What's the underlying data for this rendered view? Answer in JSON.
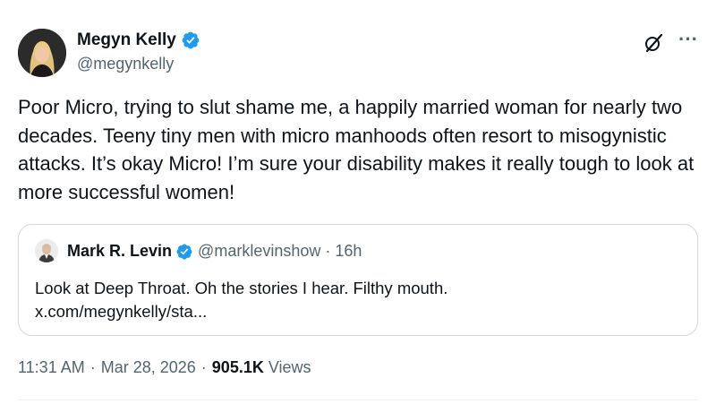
{
  "author": {
    "name": "Megyn Kelly",
    "handle": "@megynkelly",
    "verified_color": "#1d9bf0"
  },
  "icons": [
    "grok-icon",
    "more-icon"
  ],
  "tweet_text": "Poor Micro, trying to slut shame me, a happily married woman for nearly two decades. Teeny tiny men with micro manhoods often resort to misogynistic attacks. It’s okay Micro! I’m sure your disability makes it really tough to look at more successful women!",
  "quote": {
    "name": "Mark R. Levin",
    "handle": "@marklevinshow",
    "separator": "·",
    "time": "16h",
    "text_line1": "Look at Deep Throat. Oh the stories I hear.  Filthy mouth.",
    "text_line2": "x.com/megynkelly/sta..."
  },
  "footer": {
    "time": "11:31 AM",
    "date": "Mar 28, 2026",
    "separator": "·",
    "views_count": "905.1K",
    "views_label": "Views"
  }
}
